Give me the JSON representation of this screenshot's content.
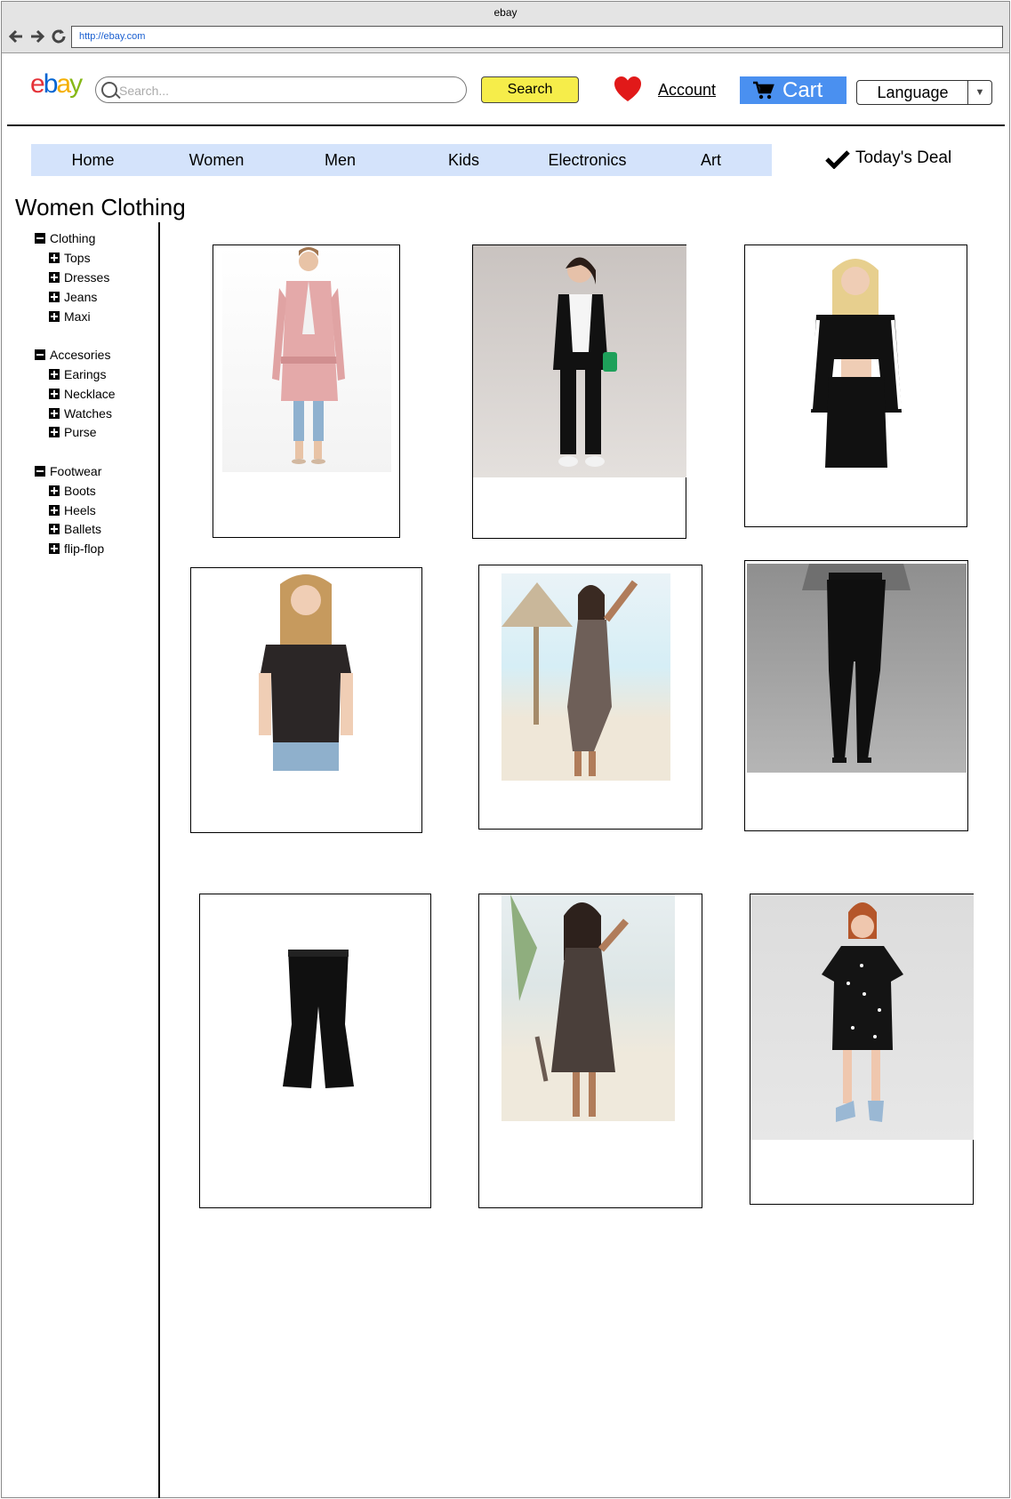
{
  "browser": {
    "window_title": "ebay",
    "url": "http://ebay.com"
  },
  "header": {
    "logo": {
      "e": "e",
      "b": "b",
      "a": "a",
      "y": "y"
    },
    "search_placeholder": "Search...",
    "search_button": "Search",
    "account": "Account",
    "cart": "Cart",
    "language": "Language"
  },
  "nav": {
    "items": [
      "Home",
      "Women",
      "Men",
      "Kids",
      "Electronics",
      "Art"
    ],
    "deal": "Today's Deal"
  },
  "page_title": "Women Clothing",
  "sidebar": {
    "groups": [
      {
        "label": "Clothing",
        "items": [
          "Tops",
          "Dresses",
          "Jeans",
          "Maxi"
        ]
      },
      {
        "label": "Accesories",
        "items": [
          "Earings",
          "Necklace",
          "Watches",
          "Purse"
        ]
      },
      {
        "label": "Footwear",
        "items": [
          "Boots",
          "Heels",
          "Ballets",
          "flip-flop"
        ]
      }
    ]
  },
  "colors": {
    "nav_bg": "#d4e3fb",
    "search_button": "#f6ed4a",
    "cart_button": "#4a90f0",
    "heart": "#e11919"
  },
  "icons": [
    "search-icon",
    "heart-icon",
    "cart-icon",
    "checkmark-icon",
    "back-arrow-icon",
    "forward-arrow-icon",
    "reload-icon",
    "dropdown-arrow-icon"
  ]
}
